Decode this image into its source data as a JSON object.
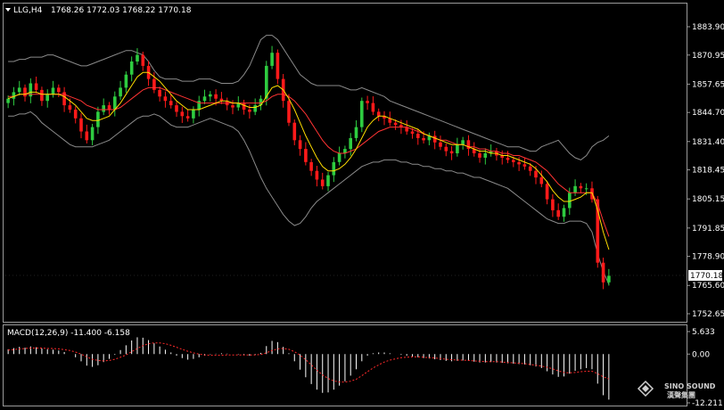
{
  "chart_data": [
    {
      "type": "candlestick",
      "title": "LLG,H4",
      "ohlc_header": "1768.26 1772.03 1768.22 1770.18",
      "ylim": [
        1752.65,
        1883.9
      ],
      "yticks": [
        "1883.90",
        "1870.95",
        "1857.65",
        "1844.70",
        "1831.40",
        "1818.45",
        "1805.15",
        "1791.85",
        "1778.90",
        "1765.60",
        "1752.65"
      ],
      "current_price": "1770.18",
      "colors": {
        "up": "#2ecc40",
        "down": "#ff1a1a",
        "bands": "#8a8a8a",
        "ma_fast": "#ffdd00",
        "ma_slow": "#ff3333"
      },
      "close": [
        1851,
        1854,
        1856,
        1852,
        1858,
        1855,
        1850,
        1853,
        1856,
        1854,
        1848,
        1846,
        1842,
        1836,
        1832,
        1838,
        1845,
        1848,
        1846,
        1852,
        1856,
        1862,
        1868,
        1871,
        1866,
        1860,
        1855,
        1852,
        1850,
        1848,
        1845,
        1843,
        1842,
        1846,
        1850,
        1852,
        1853,
        1851,
        1850,
        1848,
        1847,
        1849,
        1846,
        1845,
        1848,
        1851,
        1866,
        1872,
        1860,
        1850,
        1840,
        1832,
        1828,
        1822,
        1818,
        1814,
        1811,
        1816,
        1822,
        1826,
        1828,
        1833,
        1838,
        1850,
        1849,
        1845,
        1843,
        1842,
        1840,
        1839,
        1838,
        1836,
        1835,
        1833,
        1832,
        1834,
        1831,
        1829,
        1827,
        1826,
        1830,
        1832,
        1828,
        1826,
        1824,
        1826,
        1827,
        1825,
        1824,
        1823,
        1822,
        1821,
        1820,
        1818,
        1815,
        1812,
        1805,
        1800,
        1797,
        1801,
        1808,
        1811,
        1810,
        1810,
        1805,
        1776,
        1767,
        1770
      ],
      "upper_band": [
        1868,
        1868,
        1869,
        1869,
        1870,
        1870,
        1870,
        1871,
        1871,
        1870,
        1869,
        1868,
        1867,
        1866,
        1866,
        1867,
        1868,
        1869,
        1870,
        1871,
        1872,
        1873,
        1873,
        1872,
        1871,
        1868,
        1864,
        1861,
        1860,
        1860,
        1860,
        1859,
        1859,
        1859,
        1860,
        1860,
        1860,
        1859,
        1858,
        1858,
        1858,
        1859,
        1862,
        1866,
        1872,
        1878,
        1880,
        1880,
        1878,
        1874,
        1870,
        1866,
        1862,
        1860,
        1858,
        1857,
        1857,
        1857,
        1857,
        1857,
        1856,
        1855,
        1855,
        1856,
        1855,
        1854,
        1853,
        1852,
        1850,
        1849,
        1848,
        1847,
        1846,
        1845,
        1844,
        1843,
        1842,
        1841,
        1840,
        1839,
        1838,
        1837,
        1836,
        1835,
        1834,
        1833,
        1832,
        1831,
        1830,
        1829,
        1829,
        1829,
        1828,
        1827,
        1827,
        1829,
        1830,
        1831,
        1832,
        1829,
        1826,
        1824,
        1823,
        1825,
        1829,
        1831,
        1832,
        1834
      ],
      "lower_band": [
        1843,
        1843,
        1844,
        1844,
        1845,
        1843,
        1840,
        1838,
        1836,
        1834,
        1832,
        1830,
        1829,
        1829,
        1829,
        1829,
        1830,
        1831,
        1832,
        1834,
        1836,
        1838,
        1840,
        1842,
        1843,
        1843,
        1844,
        1843,
        1841,
        1839,
        1838,
        1838,
        1838,
        1839,
        1840,
        1841,
        1842,
        1841,
        1840,
        1839,
        1838,
        1836,
        1832,
        1827,
        1821,
        1815,
        1810,
        1806,
        1802,
        1798,
        1795,
        1793,
        1794,
        1797,
        1801,
        1804,
        1806,
        1808,
        1810,
        1812,
        1814,
        1816,
        1818,
        1820,
        1821,
        1822,
        1822,
        1823,
        1823,
        1823,
        1822,
        1822,
        1821,
        1821,
        1820,
        1820,
        1819,
        1819,
        1818,
        1818,
        1817,
        1817,
        1816,
        1815,
        1815,
        1814,
        1813,
        1812,
        1811,
        1810,
        1808,
        1806,
        1804,
        1802,
        1800,
        1798,
        1796,
        1795,
        1794,
        1794,
        1795,
        1795,
        1795,
        1794,
        1790,
        1780,
        1772,
        1766
      ],
      "ma_fast": [
        1851,
        1852,
        1853,
        1853,
        1854,
        1854,
        1853,
        1853,
        1853,
        1853,
        1852,
        1850,
        1848,
        1845,
        1842,
        1841,
        1841,
        1842,
        1843,
        1846,
        1849,
        1853,
        1857,
        1861,
        1863,
        1863,
        1861,
        1859,
        1856,
        1853,
        1850,
        1848,
        1846,
        1846,
        1846,
        1847,
        1848,
        1849,
        1850,
        1850,
        1849,
        1849,
        1848,
        1847,
        1847,
        1848,
        1852,
        1856,
        1857,
        1855,
        1851,
        1846,
        1840,
        1834,
        1829,
        1824,
        1820,
        1818,
        1818,
        1819,
        1821,
        1824,
        1828,
        1833,
        1838,
        1841,
        1843,
        1843,
        1842,
        1841,
        1840,
        1839,
        1838,
        1837,
        1835,
        1834,
        1833,
        1832,
        1831,
        1830,
        1830,
        1830,
        1829,
        1828,
        1827,
        1827,
        1826,
        1826,
        1825,
        1825,
        1824,
        1823,
        1822,
        1821,
        1819,
        1816,
        1813,
        1809,
        1806,
        1804,
        1804,
        1805,
        1806,
        1808,
        1808,
        1800,
        1790,
        1782
      ],
      "ma_slow": [
        1852,
        1852,
        1853,
        1853,
        1853,
        1853,
        1853,
        1853,
        1853,
        1853,
        1853,
        1852,
        1851,
        1850,
        1848,
        1847,
        1846,
        1846,
        1846,
        1846,
        1847,
        1849,
        1851,
        1853,
        1855,
        1856,
        1856,
        1856,
        1855,
        1854,
        1853,
        1852,
        1851,
        1850,
        1849,
        1849,
        1849,
        1849,
        1849,
        1849,
        1849,
        1849,
        1849,
        1849,
        1849,
        1849,
        1850,
        1852,
        1853,
        1853,
        1852,
        1850,
        1847,
        1844,
        1840,
        1836,
        1832,
        1829,
        1827,
        1826,
        1826,
        1827,
        1828,
        1830,
        1832,
        1834,
        1836,
        1837,
        1838,
        1838,
        1838,
        1838,
        1837,
        1836,
        1835,
        1834,
        1833,
        1832,
        1832,
        1831,
        1830,
        1830,
        1829,
        1829,
        1828,
        1828,
        1827,
        1827,
        1826,
        1826,
        1825,
        1825,
        1824,
        1823,
        1822,
        1820,
        1818,
        1815,
        1812,
        1810,
        1808,
        1808,
        1808,
        1808,
        1808,
        1803,
        1795,
        1788
      ]
    },
    {
      "type": "bar",
      "title": "MACD(12,26,9) -11.400 -6.158",
      "yticks": [
        "5.633",
        "0.00",
        "-12.211"
      ],
      "ylim": [
        -12.211,
        5.633
      ],
      "colors": {
        "histogram": "#ffffff",
        "signal": "#ff2a2a"
      },
      "macd": [
        1.2,
        1.5,
        1.8,
        1.6,
        1.9,
        1.7,
        1.4,
        1.2,
        1.1,
        0.9,
        0.5,
        0.0,
        -0.8,
        -1.8,
        -2.9,
        -3.2,
        -2.8,
        -2.0,
        -1.2,
        -0.2,
        1.0,
        2.2,
        3.4,
        4.2,
        4.1,
        3.5,
        2.7,
        1.9,
        1.1,
        0.4,
        -0.4,
        -1.0,
        -1.4,
        -1.2,
        -0.8,
        -0.4,
        -0.1,
        0.1,
        0.2,
        0.1,
        0.0,
        -0.1,
        -0.3,
        -0.4,
        -0.2,
        0.3,
        2.0,
        3.3,
        3.0,
        1.8,
        0.2,
        -1.8,
        -3.9,
        -5.8,
        -7.5,
        -8.9,
        -9.7,
        -9.6,
        -8.9,
        -7.9,
        -6.8,
        -5.4,
        -3.8,
        -1.8,
        -0.4,
        0.2,
        0.4,
        0.4,
        0.2,
        0.0,
        -0.2,
        -0.4,
        -0.6,
        -0.8,
        -1.0,
        -1.1,
        -1.3,
        -1.5,
        -1.7,
        -1.8,
        -1.7,
        -1.6,
        -1.7,
        -1.9,
        -2.1,
        -2.1,
        -2.0,
        -2.1,
        -2.2,
        -2.3,
        -2.4,
        -2.5,
        -2.6,
        -2.8,
        -3.1,
        -3.5,
        -4.3,
        -5.1,
        -5.7,
        -5.6,
        -4.9,
        -4.2,
        -3.8,
        -3.5,
        -3.8,
        -7.4,
        -10.3,
        -11.4
      ],
      "signal": [
        1.0,
        1.1,
        1.3,
        1.4,
        1.5,
        1.5,
        1.5,
        1.4,
        1.4,
        1.3,
        1.1,
        0.9,
        0.5,
        0.0,
        -0.7,
        -1.3,
        -1.6,
        -1.7,
        -1.6,
        -1.3,
        -0.8,
        -0.2,
        0.6,
        1.4,
        2.1,
        2.6,
        2.8,
        2.8,
        2.6,
        2.2,
        1.7,
        1.2,
        0.7,
        0.3,
        0.0,
        -0.2,
        -0.3,
        -0.3,
        -0.3,
        -0.2,
        -0.2,
        -0.2,
        -0.2,
        -0.2,
        -0.2,
        -0.1,
        0.3,
        0.9,
        1.3,
        1.4,
        1.2,
        0.6,
        -0.3,
        -1.4,
        -2.7,
        -4.0,
        -5.2,
        -6.1,
        -6.7,
        -7.0,
        -7.0,
        -6.8,
        -6.3,
        -5.4,
        -4.4,
        -3.5,
        -2.7,
        -2.0,
        -1.5,
        -1.2,
        -0.9,
        -0.8,
        -0.7,
        -0.7,
        -0.8,
        -0.9,
        -1.0,
        -1.1,
        -1.3,
        -1.4,
        -1.5,
        -1.5,
        -1.6,
        -1.7,
        -1.8,
        -1.9,
        -1.9,
        -1.9,
        -2.0,
        -2.1,
        -2.2,
        -2.3,
        -2.4,
        -2.6,
        -2.8,
        -3.0,
        -3.3,
        -3.7,
        -4.2,
        -4.6,
        -4.7,
        -4.6,
        -4.4,
        -4.3,
        -4.3,
        -4.9,
        -5.7,
        -6.2
      ]
    }
  ],
  "logo": {
    "name": "SINO SOUND",
    "subtitle": "漢聲集團"
  }
}
